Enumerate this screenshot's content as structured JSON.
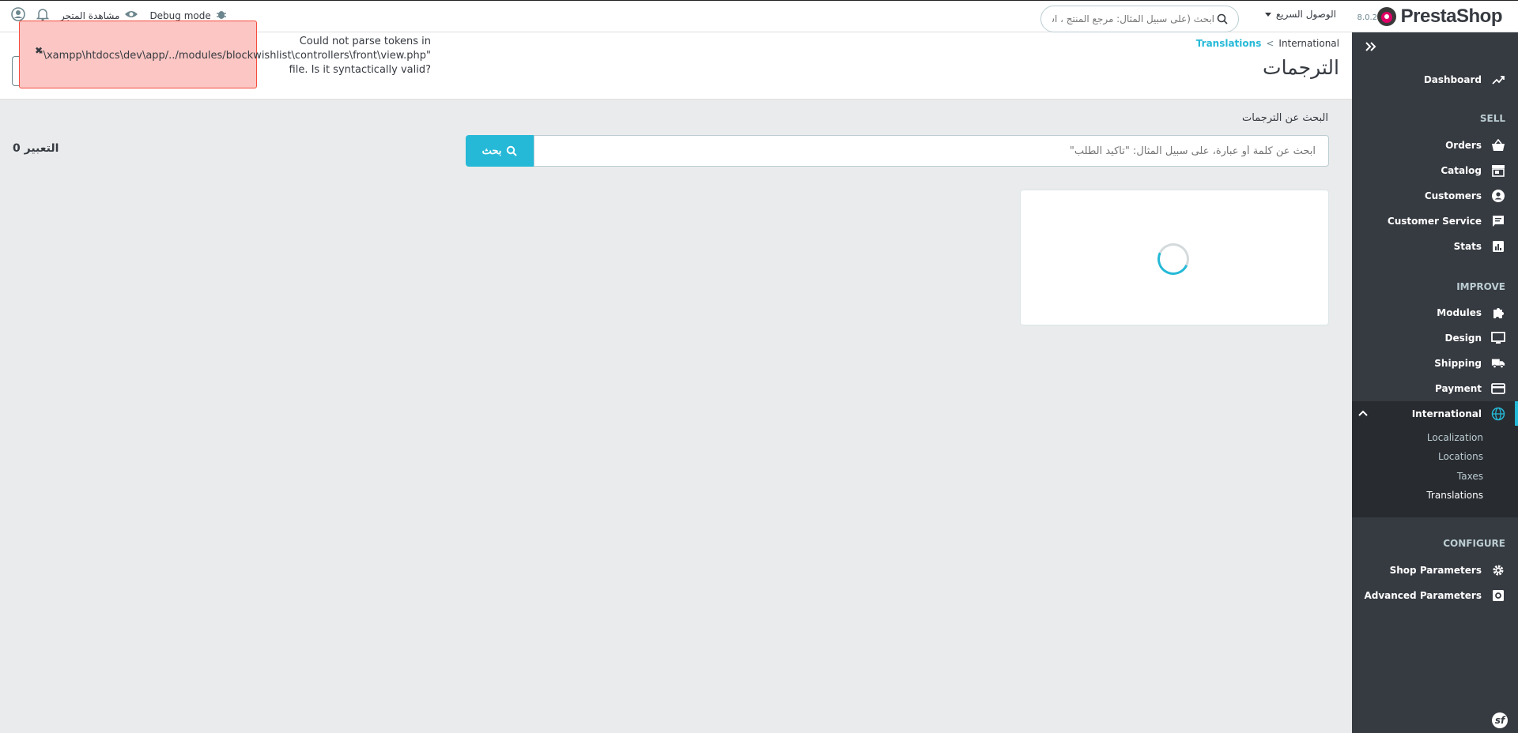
{
  "header": {
    "logo_text": "PrestaShop",
    "version": "8.0.2",
    "quick_access_label": "الوصول السريع",
    "search_placeholder": "ابحث (على سبيل المثال: مرجع المنتج ، اسم",
    "debug_mode": "Debug mode",
    "view_shop": "مشاهدة المتجر"
  },
  "toast": {
    "line1": "Could not parse tokens in",
    "line2": "\"\\xampp\\htdocs\\dev\\app/../modules/blockwishlist\\controllers\\front\\view.php\"",
    "line3": "file. Is it syntactically valid?",
    "close": "✖",
    "color": "#fbc6c3"
  },
  "breadcrumb": {
    "current": "International",
    "separator": "<",
    "link": "Translations"
  },
  "page_title": "الترجمات",
  "sidebar": {
    "items": {
      "dashboard": "Dashboard",
      "sell_section": "SELL",
      "orders": "Orders",
      "catalog": "Catalog",
      "customers": "Customers",
      "customer_service": "Customer Service",
      "stats": "Stats",
      "improve_section": "IMPROVE",
      "modules": "Modules",
      "design": "Design",
      "shipping": "Shipping",
      "payment": "Payment",
      "international": "International",
      "localization": "Localization",
      "locations": "Locations",
      "taxes": "Taxes",
      "translations": "Translations",
      "configure_section": "CONFIGURE",
      "shop_parameters": "Shop Parameters",
      "advanced_parameters": "Advanced Parameters"
    },
    "accent": "#25b9d7"
  },
  "main": {
    "search_label": "البحث عن الترجمات",
    "search_placeholder": "ابحث عن كلمة أو عبارة، على سبيل المثال: \"تأكيد الطلب\"",
    "search_button": "بحث",
    "expression_count": "0 التعبير"
  }
}
